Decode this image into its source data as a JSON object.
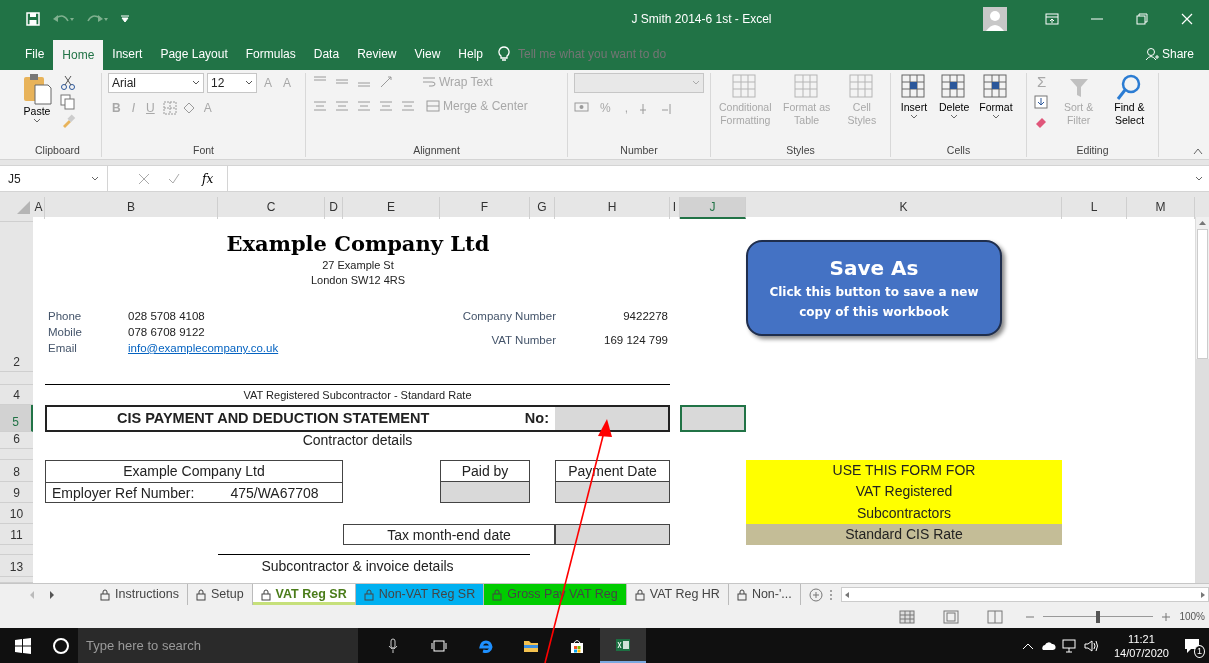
{
  "window": {
    "title": "J Smith 2014-6 1st  -  Excel"
  },
  "menu_tabs": [
    {
      "label": "File",
      "selected": false
    },
    {
      "label": "Home",
      "selected": true
    },
    {
      "label": "Insert",
      "selected": false
    },
    {
      "label": "Page Layout",
      "selected": false
    },
    {
      "label": "Formulas",
      "selected": false
    },
    {
      "label": "Data",
      "selected": false
    },
    {
      "label": "Review",
      "selected": false
    },
    {
      "label": "View",
      "selected": false
    },
    {
      "label": "Help",
      "selected": false
    }
  ],
  "tell_me": {
    "placeholder": "Tell me what you want to do"
  },
  "share": "Share",
  "ribbon": [
    {
      "kind": "clipboard",
      "label": "Clipboard",
      "paste": "Paste"
    },
    {
      "kind": "font",
      "label": "Font",
      "font_name": "Arial",
      "font_size": "12",
      "grow": "A",
      "shrink": "A",
      "styles": [
        "B",
        "I",
        "U"
      ],
      "color_button": "A"
    },
    {
      "kind": "alignment",
      "label": "Alignment",
      "wrap": "Wrap Text",
      "merge": "Merge & Center"
    },
    {
      "kind": "number",
      "label": "Number",
      "percent": "%",
      "comma": ","
    },
    {
      "kind": "styles",
      "label": "Styles",
      "buttons": [
        {
          "label": "Conditional Formatting",
          "disabled": true
        },
        {
          "label": "Format as Table",
          "disabled": true
        },
        {
          "label": "Cell Styles",
          "disabled": true
        }
      ]
    },
    {
      "kind": "cells",
      "label": "Cells",
      "buttons": [
        {
          "label": "Insert",
          "disabled": false
        },
        {
          "label": "Delete",
          "disabled": false
        },
        {
          "label": "Format",
          "disabled": false
        }
      ]
    },
    {
      "kind": "editing",
      "label": "Editing",
      "sum": "Σ",
      "buttons": [
        {
          "label": "Sort & Filter",
          "disabled": true
        },
        {
          "label": "Find & Select",
          "disabled": false
        }
      ]
    }
  ],
  "formula_bar": {
    "name_box": "J5",
    "function_label": "fx"
  },
  "columns": [
    {
      "label": "A",
      "selected": false
    },
    {
      "label": "B",
      "selected": false
    },
    {
      "label": "C",
      "selected": false
    },
    {
      "label": "D",
      "selected": false
    },
    {
      "label": "E",
      "selected": false
    },
    {
      "label": "F",
      "selected": false
    },
    {
      "label": "G",
      "selected": false
    },
    {
      "label": "H",
      "selected": false
    },
    {
      "label": "I",
      "selected": false
    },
    {
      "label": "J",
      "selected": true
    },
    {
      "label": "K",
      "selected": false
    },
    {
      "label": "L",
      "selected": false
    },
    {
      "label": "M",
      "selected": false
    }
  ],
  "rows": [
    {
      "label": "2",
      "selected": false
    },
    {
      "label": "4",
      "selected": false
    },
    {
      "label": "5",
      "selected": true
    },
    {
      "label": "6",
      "selected": false
    },
    {
      "label": "8",
      "selected": false
    },
    {
      "label": "9",
      "selected": false
    },
    {
      "label": "10",
      "selected": false
    },
    {
      "label": "11",
      "selected": false
    },
    {
      "label": "13",
      "selected": false
    }
  ],
  "sheet": {
    "company_name": "Example Company Ltd",
    "address": [
      "27 Example St",
      "London SW12 4RS"
    ],
    "contacts": [
      {
        "label": "Phone",
        "value": "028 5708 4108"
      },
      {
        "label": "Mobile",
        "value": "078 6708 9122"
      },
      {
        "label": "Email",
        "value": "info@examplecompany.co.uk",
        "kind": "link"
      }
    ],
    "registration": [
      {
        "label": "Company Number",
        "value": "9422278"
      },
      {
        "label": "VAT Number",
        "value": "169 124 799"
      }
    ],
    "subtitle": "VAT Registered Subcontractor - Standard Rate",
    "statement_title": "CIS  PAYMENT  AND  DEDUCTION  STATEMENT",
    "number_label": "No:",
    "contractor_heading": "Contractor details",
    "contractor_name": "Example Company Ltd",
    "employer_ref_label": "Employer Ref Number:",
    "employer_ref": "475/WA67708",
    "paid_by": "Paid by",
    "payment_date": "Payment Date",
    "tax_month_end": "Tax month-end date",
    "subcontractor_heading": "Subcontractor & invoice details"
  },
  "save_button": {
    "title": "Save As",
    "text": "Click this button to save a new copy of this workbook"
  },
  "notice": {
    "lines": [
      "USE THIS FORM FOR",
      "VAT Registered",
      "Subcontractors"
    ],
    "rate": "Standard CIS Rate"
  },
  "sheet_tabs": [
    {
      "label": "Instructions",
      "selected": false
    },
    {
      "label": "Setup",
      "selected": false
    },
    {
      "label": "VAT Reg SR",
      "selected": true,
      "color": "#c6e07a"
    },
    {
      "label": "Non-VAT Reg SR",
      "selected": false,
      "color": "#00b0f0"
    },
    {
      "label": "Gross Pay VAT Reg",
      "selected": false,
      "color": "#00cc00"
    },
    {
      "label": "VAT Reg HR",
      "selected": false
    },
    {
      "label": "Non-'...",
      "selected": false
    }
  ],
  "zoom": {
    "level": 0.5,
    "reading": "100%"
  },
  "taskbar": {
    "search_placeholder": "Type here to search",
    "time": "11:21",
    "date": "14/07/2020",
    "notifications": "1"
  }
}
